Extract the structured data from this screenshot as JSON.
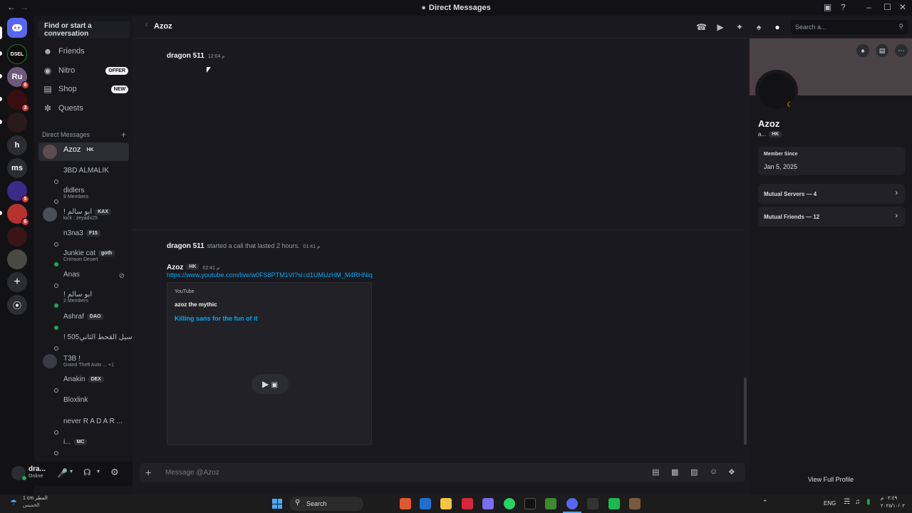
{
  "window": {
    "title": "Direct Messages"
  },
  "rail": {
    "servers": [
      {
        "label": "DSEL"
      },
      {
        "label": "Ru",
        "badge": "6"
      },
      {
        "label": "",
        "badge": "3"
      },
      {
        "label": ""
      },
      {
        "label": "h"
      },
      {
        "label": "ms"
      },
      {
        "label": "",
        "badge": "5"
      },
      {
        "label": "",
        "badge": "6"
      },
      {
        "label": ""
      },
      {
        "label": ""
      }
    ]
  },
  "dm": {
    "search": "Find or start a conversation",
    "nav": [
      {
        "label": "Friends"
      },
      {
        "label": "Nitro",
        "tag": "OFFER"
      },
      {
        "label": "Shop",
        "tag": "NEW"
      },
      {
        "label": "Quests"
      }
    ],
    "header": "Direct Messages",
    "items": [
      {
        "name": "Azoz",
        "tag": "HK",
        "sub": ""
      },
      {
        "name": "3BD ALMALIK",
        "tag": "",
        "sub": ""
      },
      {
        "name": "didlers",
        "tag": "",
        "sub": "9 Members"
      },
      {
        "name": "! ابو سالم",
        "tag": "KAX",
        "sub": "kick : zeyadx25"
      },
      {
        "name": "n3na3",
        "tag": "F15",
        "sub": ""
      },
      {
        "name": "Junkie cat",
        "tag": "goth",
        "sub": "Crimson Desert"
      },
      {
        "name": "Anas",
        "tag": "",
        "sub": ""
      },
      {
        "name": "! ابو سالم",
        "tag": "",
        "sub": "2 Members"
      },
      {
        "name": "Ashraf",
        "tag": "DAO",
        "sub": ""
      },
      {
        "name": "! 505سيل القحط الثاني",
        "tag": "",
        "sub": ""
      },
      {
        "name": "T3B !",
        "tag": "",
        "sub": "Grand Theft Auto ... +1"
      },
      {
        "name": "Anakin",
        "tag": "DEX",
        "sub": ""
      },
      {
        "name": "Bloxlink",
        "tag": "",
        "sub": ""
      },
      {
        "name": "never R A D A R ...",
        "tag": "",
        "sub": ""
      },
      {
        "name": "i...",
        "tag": "MC",
        "sub": ""
      }
    ]
  },
  "user": {
    "name": "dra...",
    "status": "Online"
  },
  "topbar": {
    "channel": "Azoz",
    "search_placeholder": "Search a..."
  },
  "messages": {
    "m1": {
      "author": "dragon 511",
      "time": "12:04 م"
    },
    "call": {
      "author": "dragon 511",
      "text": "started a call that lasted 2 hours.",
      "time": "01:41 م"
    },
    "m2": {
      "author": "Azoz",
      "tag": "HK",
      "time": "02:41 م",
      "link": "https://www.youtube.com/live/w0FS8PTM1VI?si=d1UMUzHM_M4RHNiq"
    },
    "embed": {
      "provider": "YouTube",
      "author": "azoz the mythic",
      "title": "Killing  sans for the fun of it"
    }
  },
  "composer": {
    "placeholder": "Message @Azoz"
  },
  "profile": {
    "name": "Azoz",
    "handle": "a...",
    "tag": "HK",
    "member_since_label": "Member Since",
    "member_since": "Jan 5, 2025",
    "mutual_servers": "Mutual Servers — 4",
    "mutual_friends": "Mutual Friends — 12",
    "view_full": "View Full Profile"
  },
  "taskbar": {
    "weather_line1": "1 cm المطر",
    "weather_line2": "الخميس",
    "search": "Search",
    "lang": "ENG",
    "time": "٠٢:٤٩ م",
    "date": "٢٠٢٥/١٠/٠٢"
  },
  "colors": {
    "accent": "#5865f2",
    "link": "#00a8fc",
    "online": "#23a55a",
    "danger": "#da373c"
  }
}
